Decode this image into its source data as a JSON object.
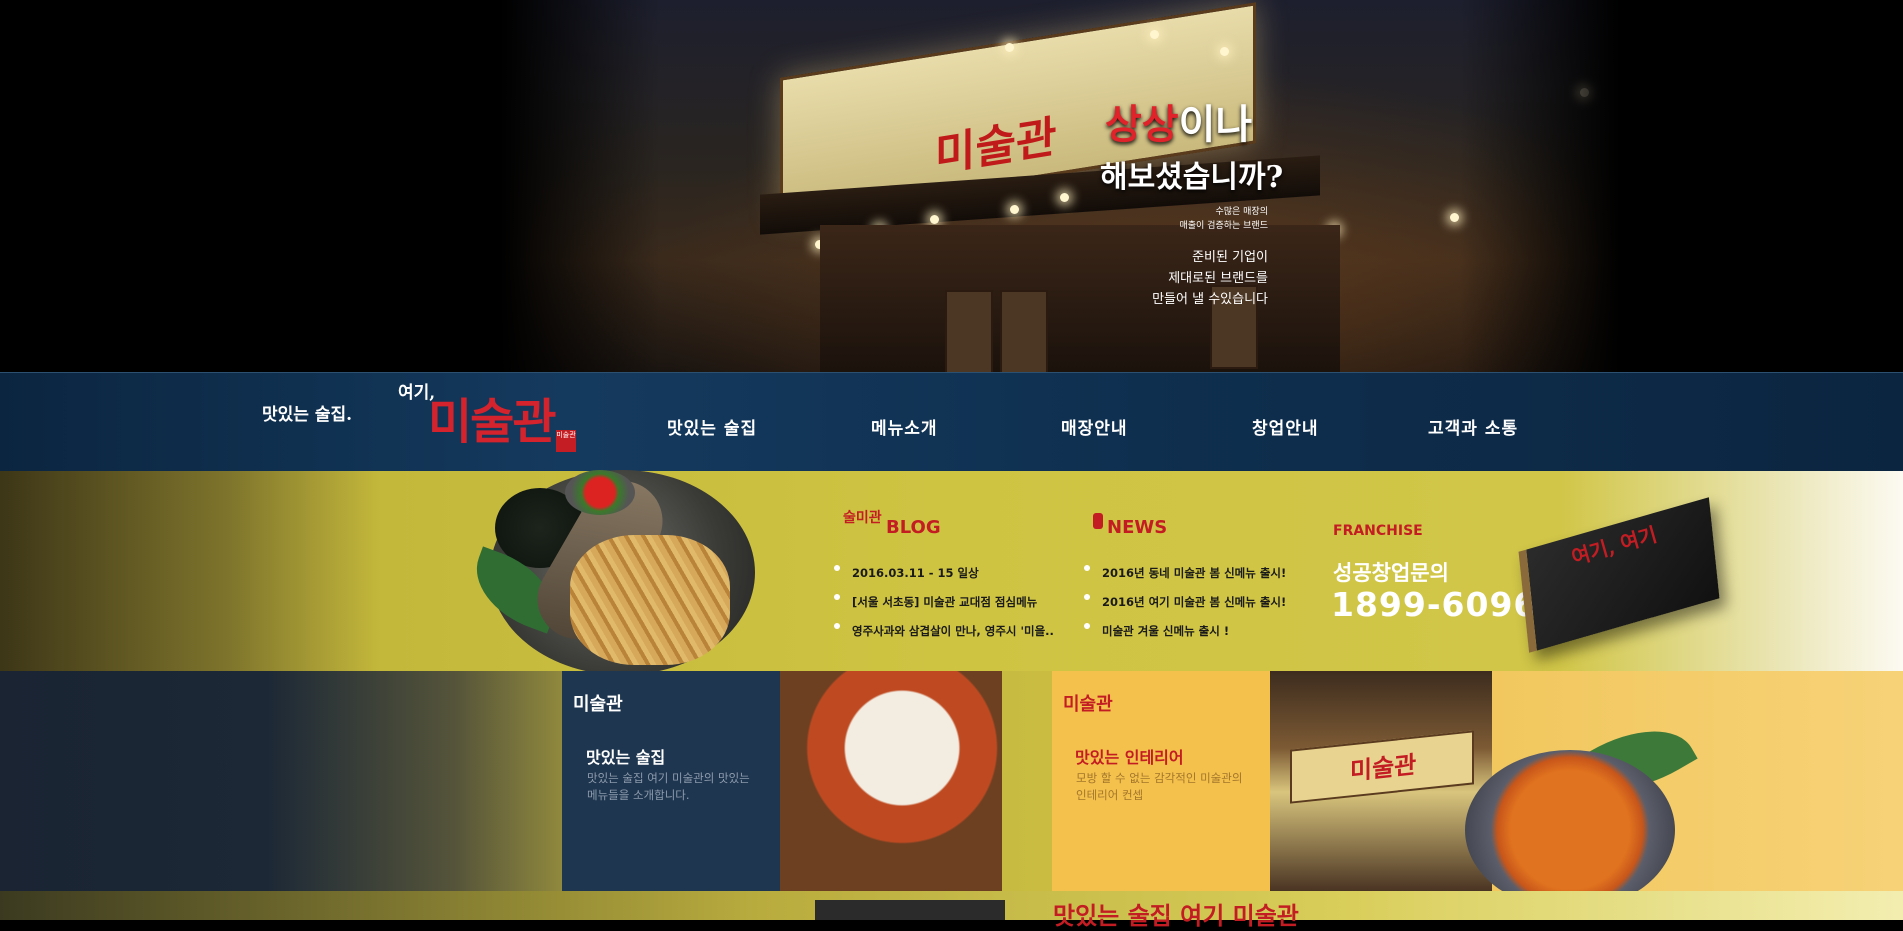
{
  "hero": {
    "headline_red": "상상",
    "headline_white": "이나",
    "headline_line2": "해보셨습니까?",
    "sub_small_1": "수많은 매장의",
    "sub_small_2": "매출이 검증하는 브랜드",
    "brush_1": "준비된 기업이",
    "brush_2": "제대로된 브랜드를",
    "brush_3": "만들어 낼 수있습니다",
    "signboard_text": "미술관"
  },
  "logo": {
    "tagline": "맛있는 술집.",
    "prefix": "여기,",
    "name": "미술관",
    "seal": "미술관"
  },
  "nav": {
    "items": [
      {
        "label": "맛있는 술집"
      },
      {
        "label": "메뉴소개"
      },
      {
        "label": "매장안내"
      },
      {
        "label": "창업안내"
      },
      {
        "label": "고객과 소통"
      }
    ]
  },
  "blog": {
    "deco": "술미관",
    "title": "BLOG",
    "items": [
      "2016.03.11 - 15 일상",
      "[서울 서초동] 미술관 교대점 점심메뉴",
      "영주사과와 삼겹살이 만나, 영주시 '미을.."
    ]
  },
  "news": {
    "title": "NEWS",
    "items": [
      "2016년 동네 미술관 봄 신메뉴 출시!",
      "2016년 여기 미술관 봄 신메뉴 출시!",
      "미술관 겨울 신메뉴 출시 !"
    ]
  },
  "franchise": {
    "label": "FRANCHISE",
    "text": "성공창업문의",
    "phone": "1899-6096",
    "book_text": "여기, 여기"
  },
  "panels": [
    {
      "logo": "미술관",
      "title": "맛있는 술집",
      "desc": "맛있는 술집 여기 미술관의 맛있는 메뉴들을 소개합니다."
    },
    {
      "logo": "미술관",
      "title": "맛있는 인테리어",
      "desc": "모방 할 수 없는 감각적인 미술관의 인테리어 컨셉",
      "sign_text": "미술관"
    }
  ],
  "bottom": {
    "title": "맛있는 술집 여기 미술관"
  },
  "colors": {
    "accent_red": "#c31d23",
    "nav_blue": "#0f2f4f",
    "band_yellow": "#cfc442",
    "panel_blue": "#1f3650",
    "panel_yellow": "#f4c14d"
  }
}
